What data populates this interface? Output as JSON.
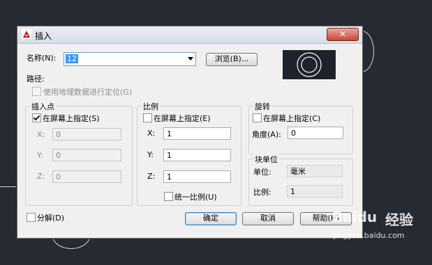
{
  "window": {
    "title": "插入",
    "close_glyph": "✕"
  },
  "name_row": {
    "label": "名称(N):",
    "value": "12",
    "browse_label": "浏览(B)..."
  },
  "path": {
    "label": "路径:"
  },
  "geo_option": {
    "label": "使用地理数据进行定位(G)",
    "checked": false
  },
  "insertion_point": {
    "title": "插入点",
    "specify_label": "在屏幕上指定(S)",
    "specify_checked": true,
    "fields": [
      {
        "label": "X:",
        "value": "0"
      },
      {
        "label": "Y:",
        "value": "0"
      },
      {
        "label": "Z:",
        "value": "0"
      }
    ]
  },
  "scale": {
    "title": "比例",
    "specify_label": "在屏幕上指定(E)",
    "specify_checked": false,
    "fields": [
      {
        "label": "X:",
        "value": "1"
      },
      {
        "label": "Y:",
        "value": "1"
      },
      {
        "label": "Z:",
        "value": "1"
      }
    ],
    "uniform_label": "统一比例(U)"
  },
  "rotation": {
    "title": "旋转",
    "specify_label": "在屏幕上指定(C)",
    "specify_checked": false,
    "angle_label": "角度(A):",
    "angle_value": "0"
  },
  "block_unit": {
    "title": "块单位",
    "unit_label": "单位:",
    "unit_value": "毫米",
    "factor_label": "比例:",
    "factor_value": "1"
  },
  "explode": {
    "label": "分解(D)",
    "checked": false
  },
  "buttons": {
    "ok": "确定",
    "cancel": "取消",
    "help": "帮助(H)"
  },
  "watermark": {
    "brand": "Baidu",
    "brand_cn": "经验",
    "site": "jingyan.baidu.com"
  }
}
